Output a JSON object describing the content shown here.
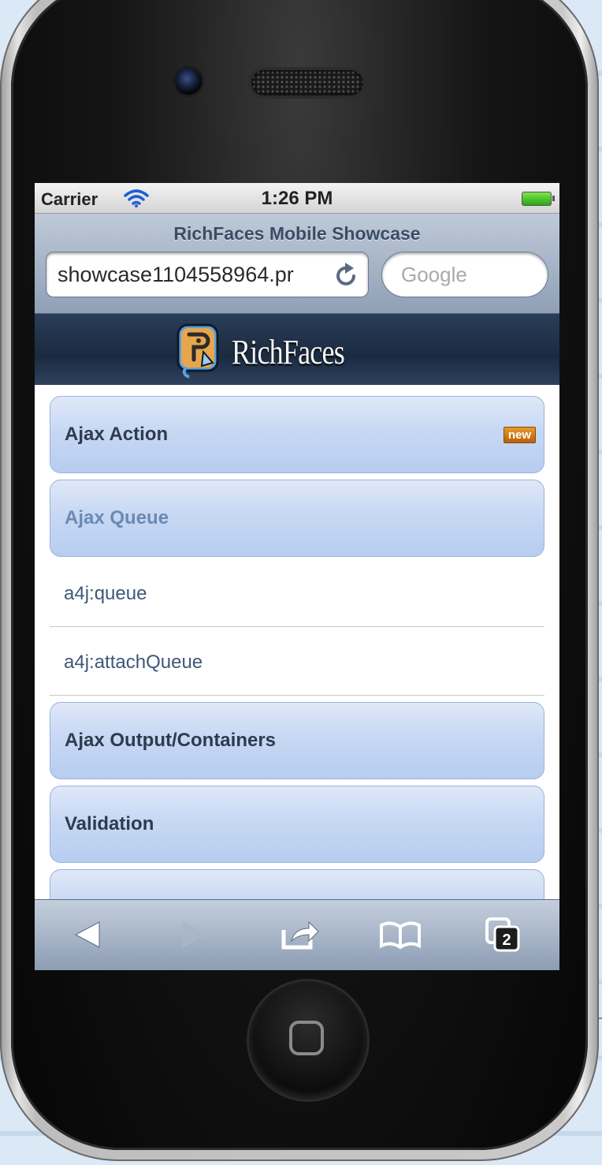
{
  "status_bar": {
    "carrier": "Carrier",
    "time": "1:26 PM"
  },
  "browser": {
    "page_title": "RichFaces Mobile Showcase",
    "url": "showcase1104558964.pr",
    "search_placeholder": "Google",
    "tabs_count": "2"
  },
  "header": {
    "logo_text": "RichFaces"
  },
  "menu": {
    "items": [
      {
        "label": "Ajax Action",
        "badge": "new"
      },
      {
        "label": "Ajax Queue"
      },
      {
        "label": "a4j:queue"
      },
      {
        "label": "a4j:attachQueue"
      },
      {
        "label": "Ajax Output/Containers"
      },
      {
        "label": "Validation"
      }
    ]
  },
  "toolbar_icons": [
    "back-icon",
    "forward-icon",
    "share-icon",
    "bookmarks-icon",
    "pages-icon"
  ],
  "colors": {
    "group_label": "#2e3b4e",
    "selected_label": "#6b89b3",
    "link": "#3e5879",
    "header_bg": "#1a2a40"
  }
}
